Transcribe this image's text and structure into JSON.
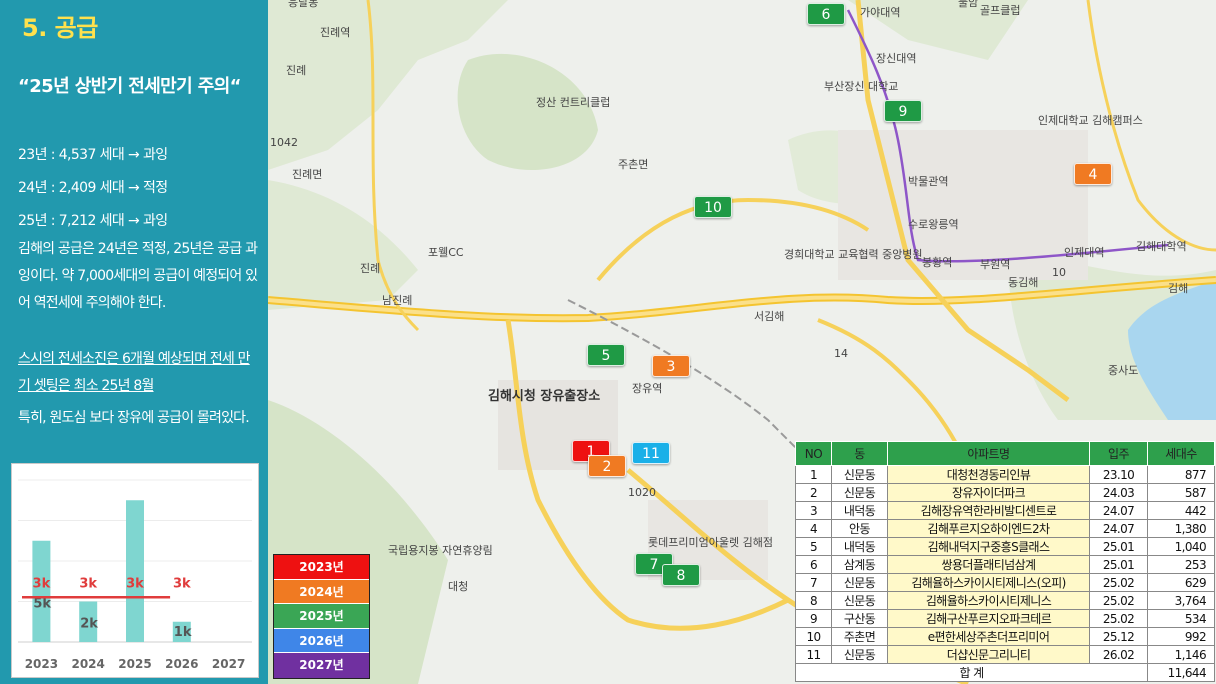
{
  "panel": {
    "section_title": "5. 공급",
    "headline": "“25년 상반기 전세만기 주의“",
    "stats": [
      "23년 : 4,537 세대 → 과잉",
      "24년 : 2,409 세대 → 적정",
      "25년 : 7,212 세대 → 과잉"
    ],
    "paragraph_1": "김해의 공급은 24년은 적정, 25년은 공급 과잉이다.  약 7,000세대의 공급이 예정되어 있어 역전세에 주의해야 한다.",
    "paragraph_2": "스시의 전세소진은  6개월 예상되며 전세 만기 셋팅은 최소 25년 8월",
    "paragraph_3": "특히, 원도심 보다 장유에 공급이 몰려있다."
  },
  "chart_data": {
    "type": "bar",
    "categories": [
      "2023",
      "2024",
      "2025",
      "2026",
      "2027"
    ],
    "values": [
      5,
      2,
      7,
      1,
      0
    ],
    "data_labels": [
      "5k",
      "2k",
      "",
      "1k",
      ""
    ],
    "reference_line": {
      "value": 3,
      "labels": [
        "3k",
        "3k",
        "3k",
        "3k"
      ],
      "color": "#e03c3c"
    },
    "bar_color": "#7fd6d0",
    "ylim": [
      0,
      8
    ],
    "grid": true
  },
  "map": {
    "labels": [
      "진례역",
      "진례",
      "진례면",
      "진례",
      "남진례",
      "정산 컨트리클럽",
      "포웰CC",
      "주촌면",
      "가야대역",
      "장신대역",
      "부산장신 대학교",
      "인제대학교 김해캠퍼스",
      "박물관역",
      "수로왕릉역",
      "봉황역",
      "부원역",
      "인제대역",
      "김해대학역",
      "경희대학교 교육협력 중앙병원",
      "동김해",
      "서김해",
      "장유역",
      "김해시청 장유출장소",
      "롯데프리미엄아울렛 김해점",
      "국립용지봉 자연휴양림",
      "대청",
      "응달동",
      "중사도",
      "김해",
      "불암",
      "골프클럽",
      "1042",
      "1020",
      "14",
      "10"
    ]
  },
  "markers": [
    {
      "label": "6",
      "color": "#1f9a45"
    },
    {
      "label": "9",
      "color": "#1f9a45"
    },
    {
      "label": "4",
      "color": "#f07a22"
    },
    {
      "label": "10",
      "color": "#1f9a45"
    },
    {
      "label": "5",
      "color": "#1f9a45"
    },
    {
      "label": "3",
      "color": "#f07a22"
    },
    {
      "label": "1",
      "color": "#ee1111"
    },
    {
      "label": "2",
      "color": "#f07a22"
    },
    {
      "label": "11",
      "color": "#1ab0e8"
    },
    {
      "label": "7",
      "color": "#1f9a45"
    },
    {
      "label": "8",
      "color": "#1f9a45"
    }
  ],
  "legend": [
    {
      "label": "2023년",
      "color": "#ee1111"
    },
    {
      "label": "2024년",
      "color": "#f07a22"
    },
    {
      "label": "2025년",
      "color": "#3aa655"
    },
    {
      "label": "2026년",
      "color": "#3f86e8"
    },
    {
      "label": "2027년",
      "color": "#7030a0"
    }
  ],
  "table": {
    "headers": [
      "NO",
      "동",
      "아파트명",
      "입주",
      "세대수"
    ],
    "rows": [
      [
        "1",
        "신문동",
        "대청천경동리인뷰",
        "23.10",
        "877"
      ],
      [
        "2",
        "신문동",
        "장유자이더파크",
        "24.03",
        "587"
      ],
      [
        "3",
        "내덕동",
        "김해장유역한라비발디센트로",
        "24.07",
        "442"
      ],
      [
        "4",
        "안동",
        "김해푸르지오하이엔드2차",
        "24.07",
        "1,380"
      ],
      [
        "5",
        "내덕동",
        "김해내덕지구중흥S클래스",
        "25.01",
        "1,040"
      ],
      [
        "6",
        "삼계동",
        "쌍용더플래티넘삼계",
        "25.01",
        "253"
      ],
      [
        "7",
        "신문동",
        "김해율하스카이시티제니스(오피)",
        "25.02",
        "629"
      ],
      [
        "8",
        "신문동",
        "김해율하스카이시티제니스",
        "25.02",
        "3,764"
      ],
      [
        "9",
        "구산동",
        "김해구산푸르지오파크테르",
        "25.02",
        "534"
      ],
      [
        "10",
        "주촌면",
        "e편한세상주촌더프리미어",
        "25.12",
        "992"
      ],
      [
        "11",
        "신문동",
        "더샵신문그리니티",
        "26.02",
        "1,146"
      ]
    ],
    "total_label": "합 계",
    "total_value": "11,644"
  }
}
